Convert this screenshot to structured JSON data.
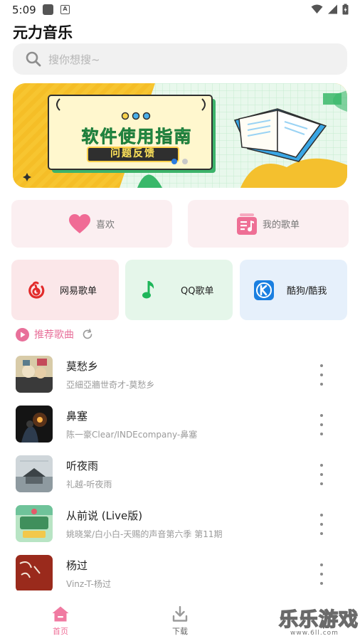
{
  "status_bar": {
    "time": "5:09"
  },
  "app": {
    "title": "元力音乐"
  },
  "search": {
    "placeholder": "搜你想搜~"
  },
  "banner": {
    "title": "软件使用指南",
    "button": "问题反馈"
  },
  "quick_links": [
    {
      "label": "喜欢",
      "icon": "heart-icon"
    },
    {
      "label": "我的歌单",
      "icon": "playlist-icon"
    }
  ],
  "platforms": [
    {
      "label": "网易歌单",
      "icon": "netease-music-icon"
    },
    {
      "label": "QQ歌单",
      "icon": "qq-music-icon"
    },
    {
      "label": "酷狗/酷我",
      "icon": "kugou-icon"
    }
  ],
  "section": {
    "title": "推荐歌曲"
  },
  "songs": [
    {
      "title": "莫愁乡",
      "subtitle": "亞細亞牆世奇才-莫愁乡"
    },
    {
      "title": "鼻塞",
      "subtitle": "陈一豪Clear/INDEcompany-鼻塞"
    },
    {
      "title": "听夜雨",
      "subtitle": "礼越-听夜雨"
    },
    {
      "title": "从前说 (Live版)",
      "subtitle": "姚晓棠/白小白-天赐的声音第六季 第11期"
    },
    {
      "title": "杨过",
      "subtitle": "Vinz-T-杨过"
    }
  ],
  "bottom_nav": [
    {
      "label": "首页",
      "active": true
    },
    {
      "label": "下载",
      "active": false
    }
  ],
  "watermark": {
    "text": "乐乐游戏",
    "url": "www.6ll.com"
  },
  "colors": {
    "accent": "#e8709a",
    "banner_bg": "#f7c530",
    "netease": "#e22b2b",
    "qq": "#1eb65a",
    "kugou": "#1a7fe0"
  }
}
